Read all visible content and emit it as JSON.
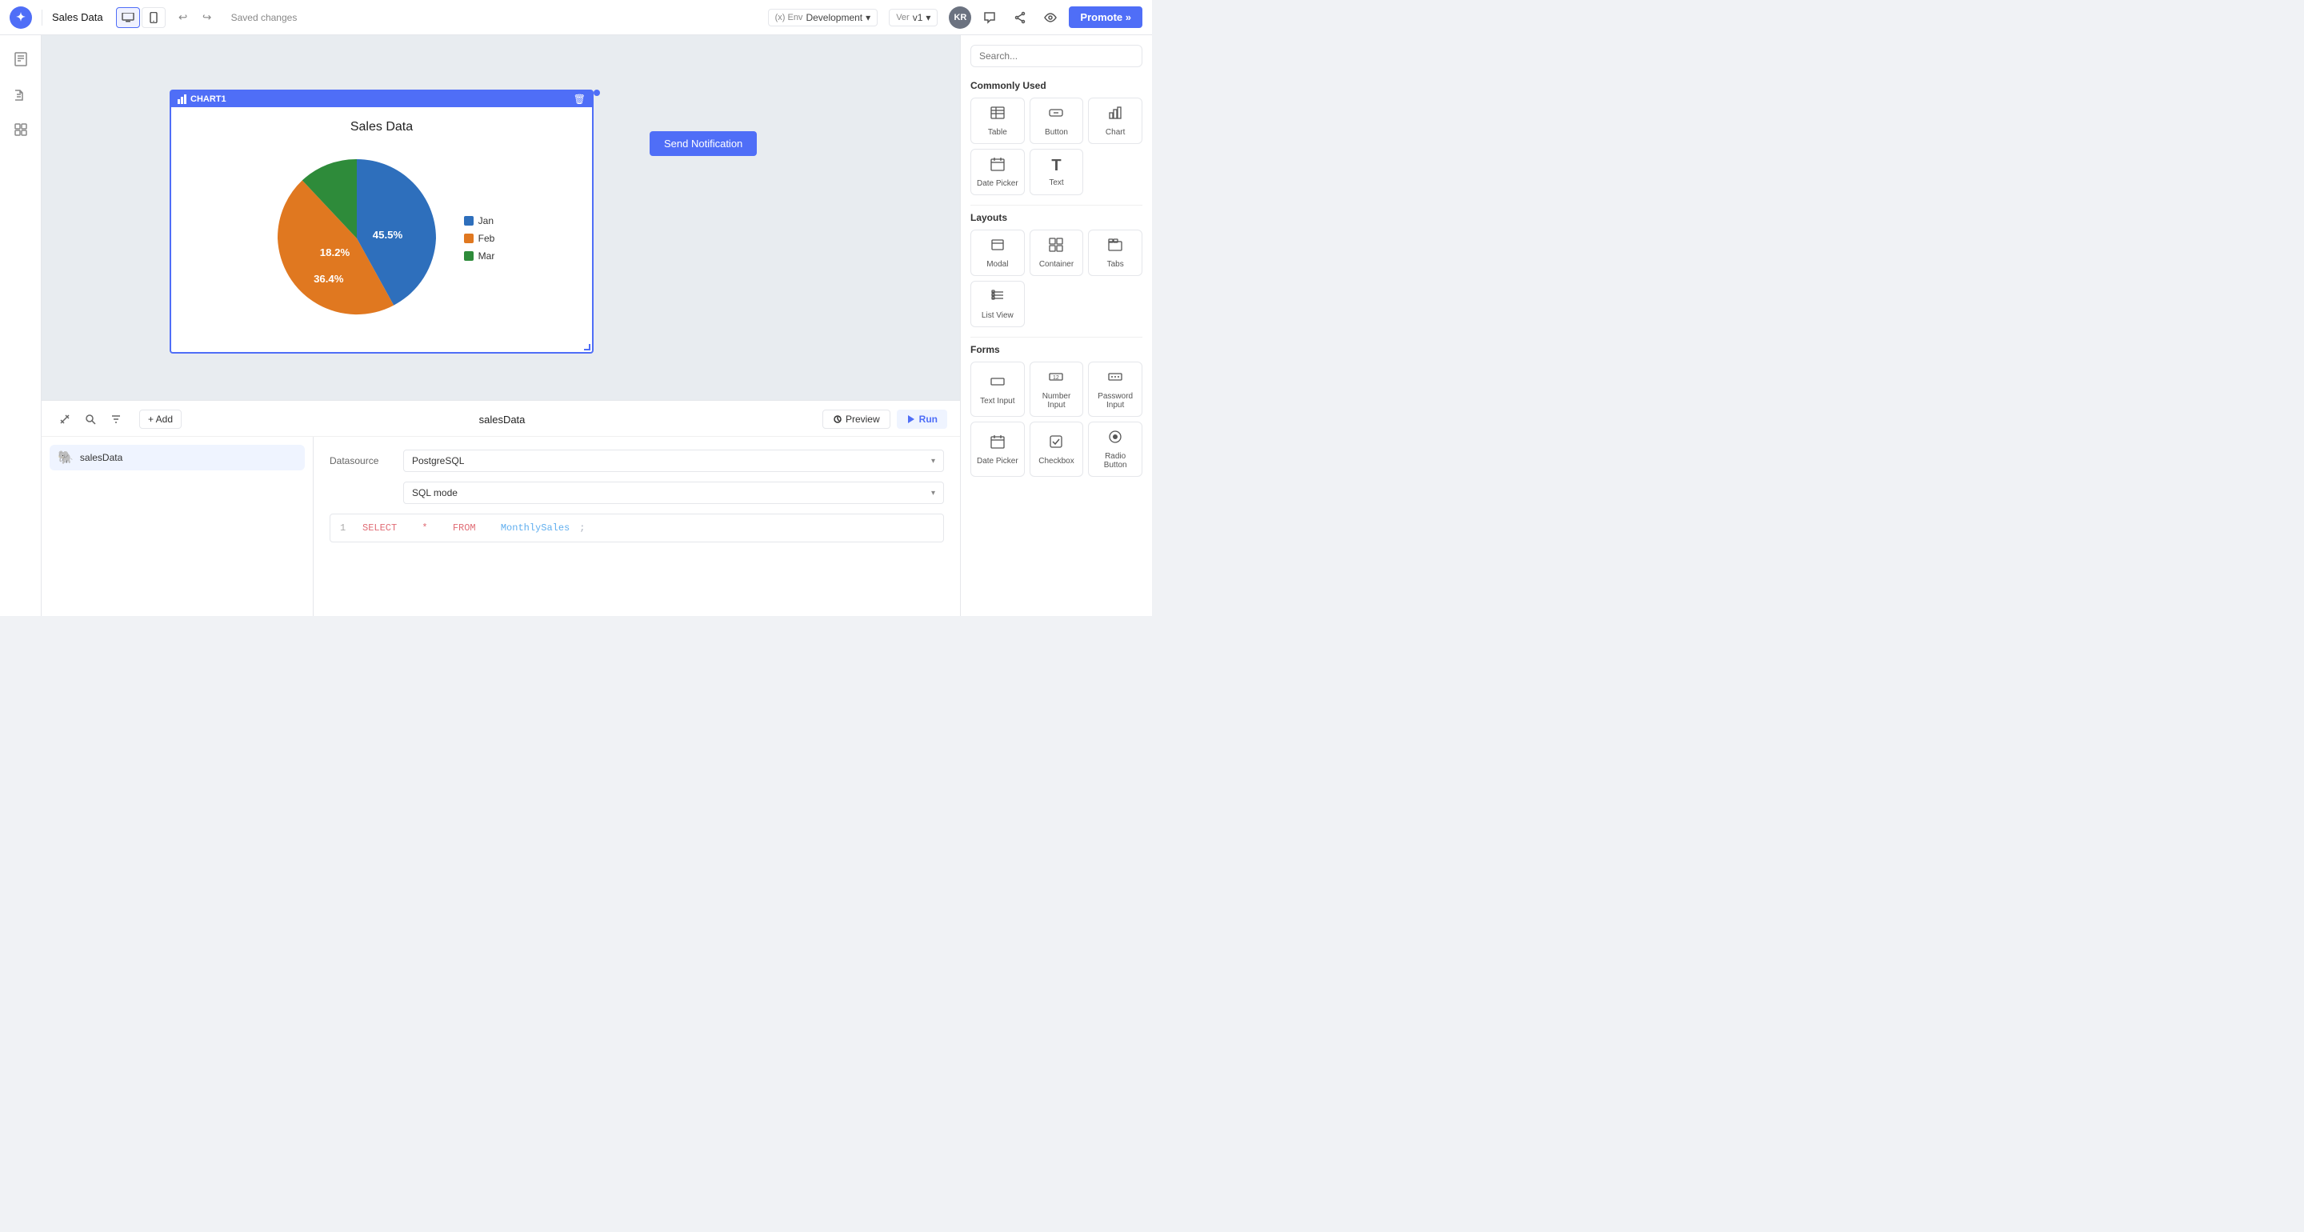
{
  "topbar": {
    "logo_text": "✦",
    "app_name": "Sales Data",
    "saved_label": "Saved changes",
    "env_prefix": "(x) Env",
    "env_value": "Development",
    "ver_prefix": "Ver",
    "ver_value": "v1",
    "avatar_initials": "KR",
    "promote_label": "Promote »"
  },
  "canvas": {
    "chart_label": "CHART1",
    "chart_title": "Sales Data",
    "send_notification_label": "Send Notification",
    "pie_slices": [
      {
        "label": "Jan",
        "value": "45.5%",
        "color": "#2e6fbc",
        "start": 0,
        "angle": 163.8
      },
      {
        "label": "Feb",
        "value": "36.4%",
        "color": "#e07820",
        "start": 163.8,
        "angle": 131.0
      },
      {
        "label": "Mar",
        "value": "18.2%",
        "color": "#2e8b3a",
        "start": 294.8,
        "angle": 65.5
      }
    ]
  },
  "bottom_panel": {
    "query_name": "salesData",
    "preview_label": "Preview",
    "run_label": "Run",
    "add_label": "+ Add",
    "datasource_label": "Datasource",
    "datasource_value": "PostgreSQL",
    "sql_mode_value": "SQL mode",
    "sql_query": "SELECT * FROM MonthlySales;"
  },
  "right_sidebar": {
    "search_placeholder": "Search...",
    "sections": [
      {
        "title": "Commonly Used",
        "items": [
          {
            "icon": "⊞",
            "label": "Table"
          },
          {
            "icon": "◻",
            "label": "Button"
          },
          {
            "icon": "📊",
            "label": "Chart"
          }
        ]
      },
      {
        "title": "",
        "items": [
          {
            "icon": "📅",
            "label": "Date Picker"
          },
          {
            "icon": "T",
            "label": "Text"
          }
        ]
      },
      {
        "title": "Layouts",
        "items": [
          {
            "icon": "⬜",
            "label": "Modal"
          },
          {
            "icon": "⊞",
            "label": "Container"
          },
          {
            "icon": "⊟",
            "label": "Tabs"
          }
        ]
      },
      {
        "title": "",
        "items": [
          {
            "icon": "☰",
            "label": "List View"
          }
        ]
      },
      {
        "title": "Forms",
        "items": [
          {
            "icon": "▭",
            "label": "Text Input"
          },
          {
            "icon": "12",
            "label": "Number Input"
          },
          {
            "icon": "**",
            "label": "Password Input"
          }
        ]
      },
      {
        "title": "",
        "items": [
          {
            "icon": "📅",
            "label": "Date Picker"
          },
          {
            "icon": "☑",
            "label": "Checkbox"
          },
          {
            "icon": "⊙",
            "label": "Radio Button"
          }
        ]
      }
    ]
  }
}
